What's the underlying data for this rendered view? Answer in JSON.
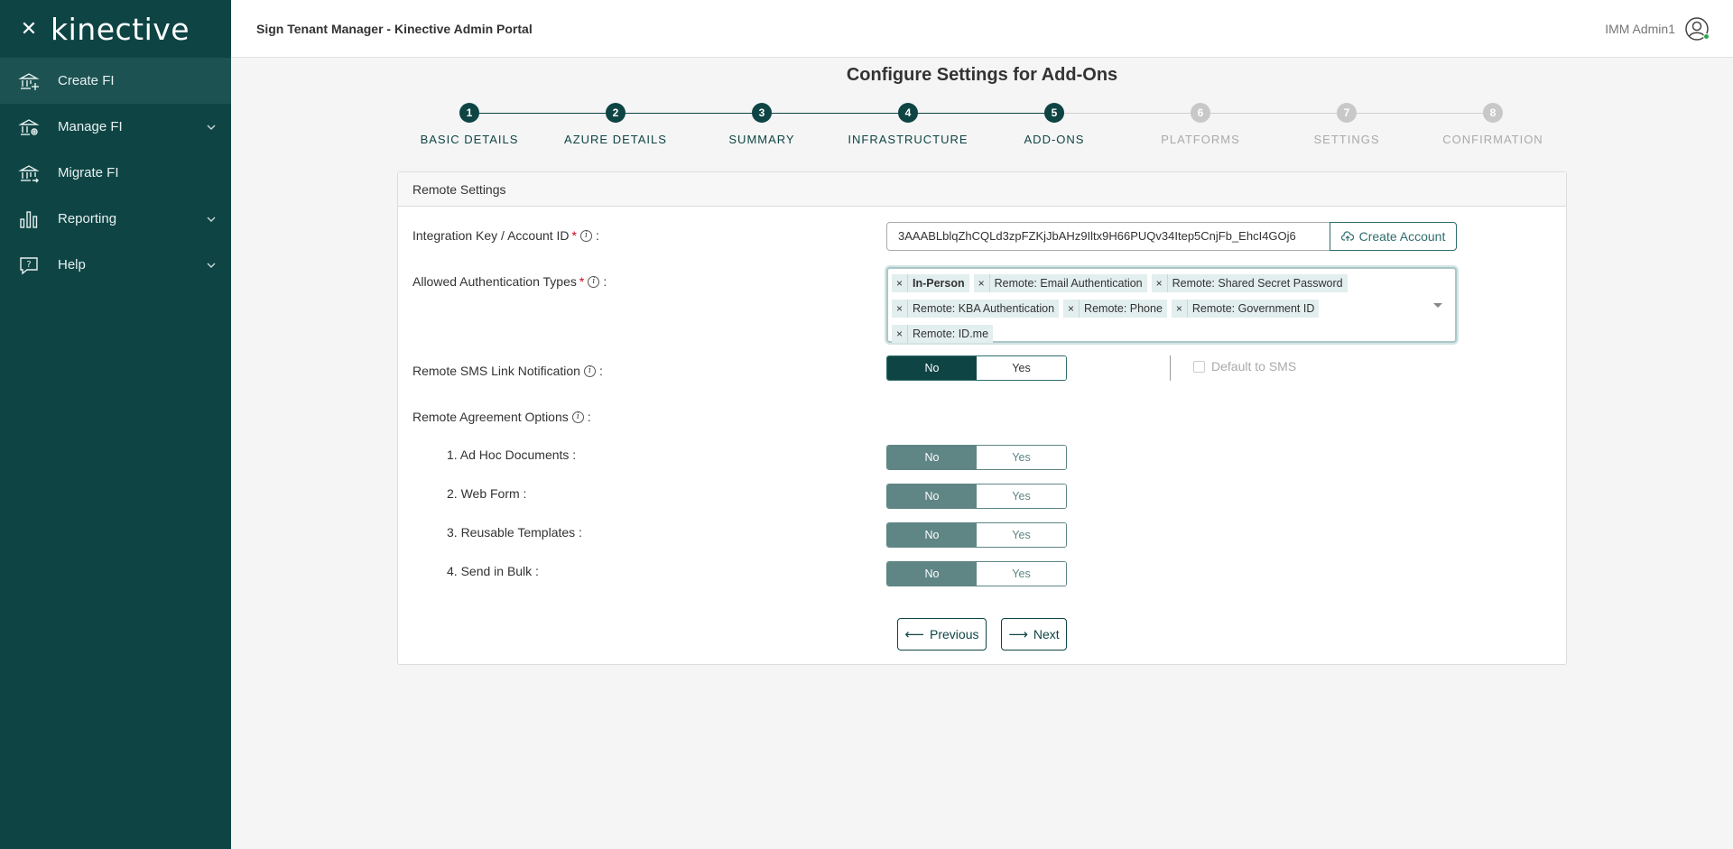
{
  "sidebar": {
    "logo": "kinective",
    "items": [
      {
        "label": "Create FI",
        "icon": "bank-plus-icon",
        "active": true,
        "expandable": false
      },
      {
        "label": "Manage FI",
        "icon": "bank-settings-icon",
        "active": false,
        "expandable": true
      },
      {
        "label": "Migrate FI",
        "icon": "bank-migrate-icon",
        "active": false,
        "expandable": false
      },
      {
        "label": "Reporting",
        "icon": "bar-chart-icon",
        "active": false,
        "expandable": true
      },
      {
        "label": "Help",
        "icon": "help-chat-icon",
        "active": false,
        "expandable": true
      }
    ]
  },
  "header": {
    "title": "Sign Tenant Manager - Kinective Admin Portal",
    "user_name": "IMM Admin1"
  },
  "page_title": "Configure Settings for Add-Ons",
  "stepper": {
    "steps": [
      {
        "number": "1",
        "label": "BASIC DETAILS",
        "state": "done"
      },
      {
        "number": "2",
        "label": "AZURE DETAILS",
        "state": "done"
      },
      {
        "number": "3",
        "label": "SUMMARY",
        "state": "done"
      },
      {
        "number": "4",
        "label": "INFRASTRUCTURE",
        "state": "done"
      },
      {
        "number": "5",
        "label": "ADD-ONS",
        "state": "current"
      },
      {
        "number": "6",
        "label": "PLATFORMS",
        "state": "pending"
      },
      {
        "number": "7",
        "label": "SETTINGS",
        "state": "pending"
      },
      {
        "number": "8",
        "label": "CONFIRMATION",
        "state": "pending"
      }
    ]
  },
  "card": {
    "title": "Remote Settings",
    "integration_key": {
      "label": "Integration Key / Account ID",
      "value": "3AAABLblqZhCQLd3zpFZKjJbAHz9Iltx9H66PUQv34Itep5CnjFb_EhcI4GOj6",
      "button": "Create Account"
    },
    "auth_types": {
      "label": "Allowed Authentication Types",
      "chips": [
        {
          "text": "In-Person",
          "bold": true
        },
        {
          "text": "Remote: Email Authentication",
          "bold": false
        },
        {
          "text": "Remote: Shared Secret Password",
          "bold": false
        },
        {
          "text": "Remote: KBA Authentication",
          "bold": false
        },
        {
          "text": "Remote: Phone",
          "bold": false
        },
        {
          "text": "Remote: Government ID",
          "bold": false
        },
        {
          "text": "Remote: ID.me",
          "bold": false
        }
      ]
    },
    "sms": {
      "label": "Remote SMS Link Notification",
      "no": "No",
      "yes": "Yes",
      "selected": "No",
      "default_to_sms": "Default to SMS"
    },
    "agreement_options": {
      "label": "Remote Agreement Options",
      "items": [
        {
          "label": "1. Ad Hoc Documents :",
          "no": "No",
          "yes": "Yes",
          "selected": "No"
        },
        {
          "label": "2. Web Form :",
          "no": "No",
          "yes": "Yes",
          "selected": "No"
        },
        {
          "label": "3. Reusable Templates :",
          "no": "No",
          "yes": "Yes",
          "selected": "No"
        },
        {
          "label": "4. Send in Bulk :",
          "no": "No",
          "yes": "Yes",
          "selected": "No"
        }
      ]
    },
    "buttons": {
      "previous": "Previous",
      "next": "Next"
    }
  },
  "colors": {
    "sidebar_bg": "#0f4444",
    "sidebar_active": "#1d5252",
    "accent": "#0f4444",
    "muted_toggle": "#5f8585",
    "pending_step": "#c8c8c8",
    "required": "#d0021b"
  }
}
